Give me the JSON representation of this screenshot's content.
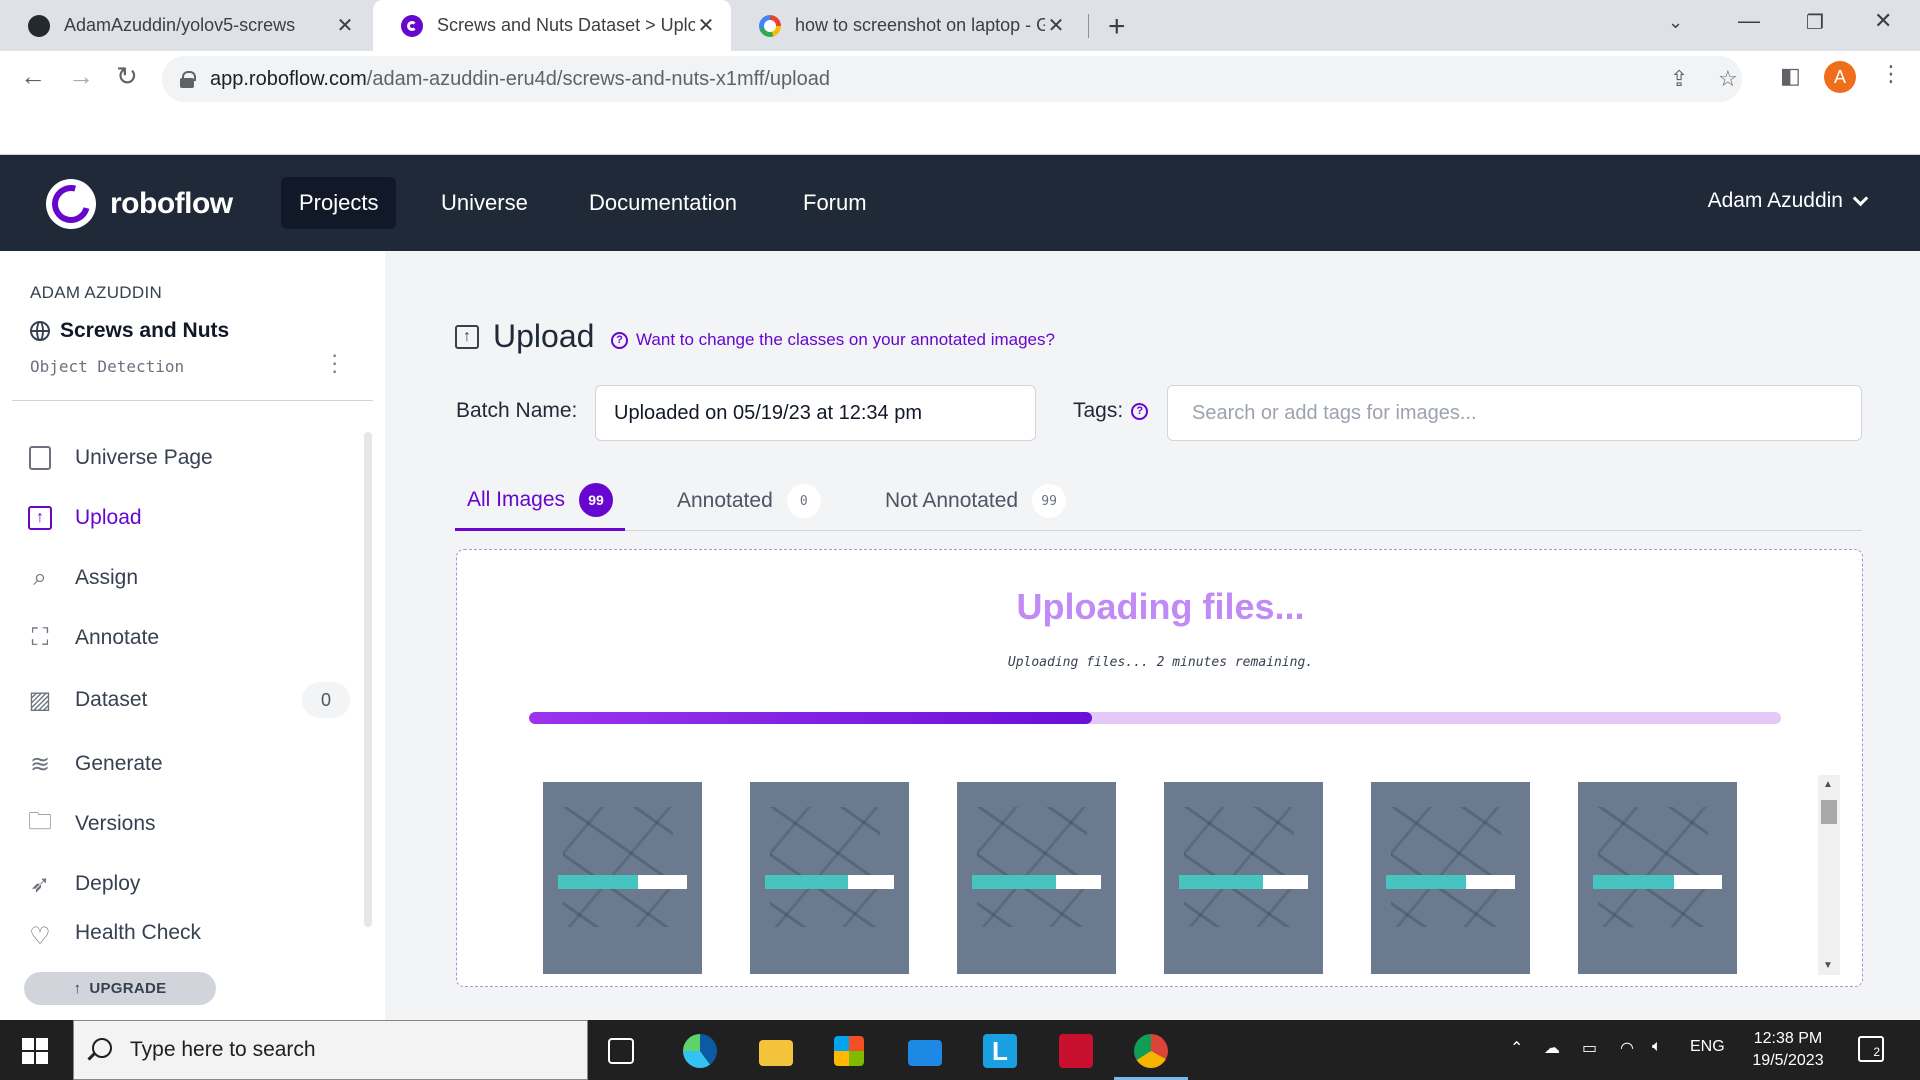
{
  "browser": {
    "tabs": [
      {
        "title": "AdamAzuddin/yolov5-screws",
        "favicon": "github-icon",
        "active": false
      },
      {
        "title": "Screws and Nuts Dataset > Uploa",
        "favicon": "roboflow-icon",
        "active": true
      },
      {
        "title": "how to screenshot on laptop - Go",
        "favicon": "google-icon",
        "active": false
      }
    ],
    "url_host": "app.roboflow.com",
    "url_path": "/adam-azuddin-eru4d/screws-and-nuts-x1mff/upload",
    "profile_initial": "A",
    "profile_color": "#f06d1c"
  },
  "header": {
    "logo_text": "roboflow",
    "nav": [
      "Projects",
      "Universe",
      "Documentation",
      "Forum"
    ],
    "active_nav": "Projects",
    "user_name": "Adam Azuddin",
    "bg_color": "#1f2937",
    "accent_color": "#6706ce"
  },
  "sidebar": {
    "workspace": "ADAM AZUDDIN",
    "project_name": "Screws and Nuts",
    "project_type": "Object Detection",
    "items": [
      {
        "label": "Universe Page",
        "icon": "book-icon"
      },
      {
        "label": "Upload",
        "icon": "upload-icon",
        "active": true
      },
      {
        "label": "Assign",
        "icon": "search-icon"
      },
      {
        "label": "Annotate",
        "icon": "annotate-icon"
      },
      {
        "label": "Dataset",
        "icon": "images-icon",
        "count": "0"
      },
      {
        "label": "Generate",
        "icon": "layers-icon"
      },
      {
        "label": "Versions",
        "icon": "folders-icon"
      },
      {
        "label": "Deploy",
        "icon": "rocket-icon"
      },
      {
        "label": "Health Check",
        "icon": "health-icon"
      }
    ],
    "upgrade_label": "UPGRADE"
  },
  "main": {
    "title": "Upload",
    "help_link": "Want to change the classes on your annotated images?",
    "batch_label": "Batch Name:",
    "batch_value": "Uploaded on 05/19/23 at 12:34 pm",
    "tags_label": "Tags:",
    "tags_placeholder": "Search or add tags for images...",
    "filter_tabs": [
      {
        "label": "All Images",
        "count": "99",
        "active": true
      },
      {
        "label": "Annotated",
        "count": "0"
      },
      {
        "label": "Not Annotated",
        "count": "99"
      }
    ],
    "upload_status_title": "Uploading files...",
    "upload_status_sub": "Uploading files... 2 minutes remaining.",
    "upload_progress": 0.45,
    "thumbnails": [
      {
        "progress": 0.62
      },
      {
        "progress": 0.64
      },
      {
        "progress": 0.65
      },
      {
        "progress": 0.65
      },
      {
        "progress": 0.62
      },
      {
        "progress": 0.63
      }
    ]
  },
  "taskbar": {
    "search_placeholder": "Type here to search",
    "language": "ENG",
    "time": "12:38 PM",
    "date": "19/5/2023",
    "notification_count": "2"
  }
}
